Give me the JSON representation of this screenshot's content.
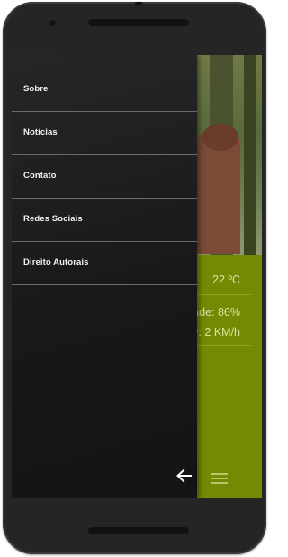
{
  "drawer": {
    "items": [
      {
        "label": "Sobre"
      },
      {
        "label": "Notícias"
      },
      {
        "label": "Contato"
      },
      {
        "label": "Redes Sociais"
      },
      {
        "label": "Direito Autorais"
      }
    ],
    "back_icon": "arrow-left-icon"
  },
  "weather": {
    "temperature": "22 ºC",
    "humidity": "ade: 86%",
    "wind": "y: 2 KM/h"
  },
  "app_bar": {
    "menu_icon": "hamburger-menu-icon"
  },
  "colors": {
    "accent_green": "#728b02",
    "drawer_bg": "#1c1c1c",
    "drawer_text": "#f2f2f2",
    "divider": "#6b6b6b"
  }
}
